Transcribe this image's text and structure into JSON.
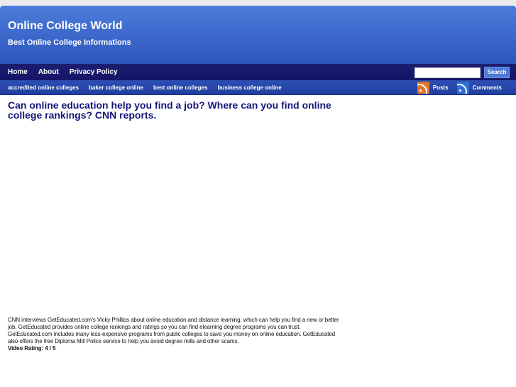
{
  "site": {
    "title": "Online College World",
    "tagline": "Best Online College Informations"
  },
  "nav": {
    "items": [
      "Home",
      "About",
      "Privacy Policy"
    ],
    "search_button": "Search",
    "search_value": ""
  },
  "subnav": {
    "items": [
      "accredited online colleges",
      "baker college online",
      "best online colleges",
      "business college online"
    ],
    "feeds": [
      {
        "label": "Posts",
        "color": "#e0772a"
      },
      {
        "label": "Comments",
        "color": "#2e6fd6"
      }
    ]
  },
  "post": {
    "title": "Can online education help you find a job? Where can you find online college rankings? CNN reports.",
    "description": "CNN interviews GetEducated.com's Vicky Phillips about online education and distance learning, which can help you find a new or better job. GetEducated provides online college rankings and ratings so you can find elearning degree programs you can trust. GetEducated.com includes many less-expensive programs from public colleges to save you money on online education. GetEducated also offers the free Diploma Mill Police service to help you avoid degree mills and other scams.",
    "rating_label": "Video Rating:",
    "rating_value": "4 / 5"
  }
}
